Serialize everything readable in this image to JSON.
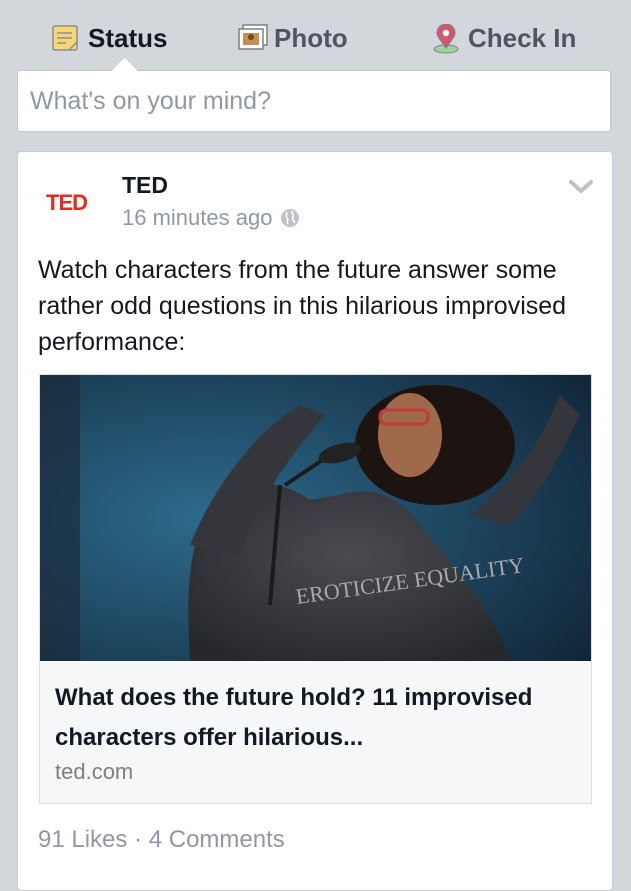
{
  "composer": {
    "tabs": [
      {
        "label": "Status",
        "icon": "status-note-icon"
      },
      {
        "label": "Photo",
        "icon": "photo-icon"
      },
      {
        "label": "Check In",
        "icon": "location-pin-icon"
      }
    ],
    "placeholder": "What's on your mind?"
  },
  "post": {
    "logo_text": "TED",
    "author": "TED",
    "timestamp": "16 minutes ago",
    "privacy_icon": "globe-icon",
    "menu_icon": "chevron-down-icon",
    "text": "Watch characters from the future answer some rather odd questions in this hilarious improvised performance:",
    "link": {
      "image_caption_text": "EROTICIZE EQUALITY",
      "title": "What does the future hold? 11 improvised characters offer hilarious...",
      "domain": "ted.com"
    },
    "likes": "91 Likes",
    "separator": "·",
    "comments": "4 Comments"
  },
  "colors": {
    "background": "#d3d6db",
    "ted_red": "#e62b1e",
    "muted_text": "#9197a3"
  }
}
